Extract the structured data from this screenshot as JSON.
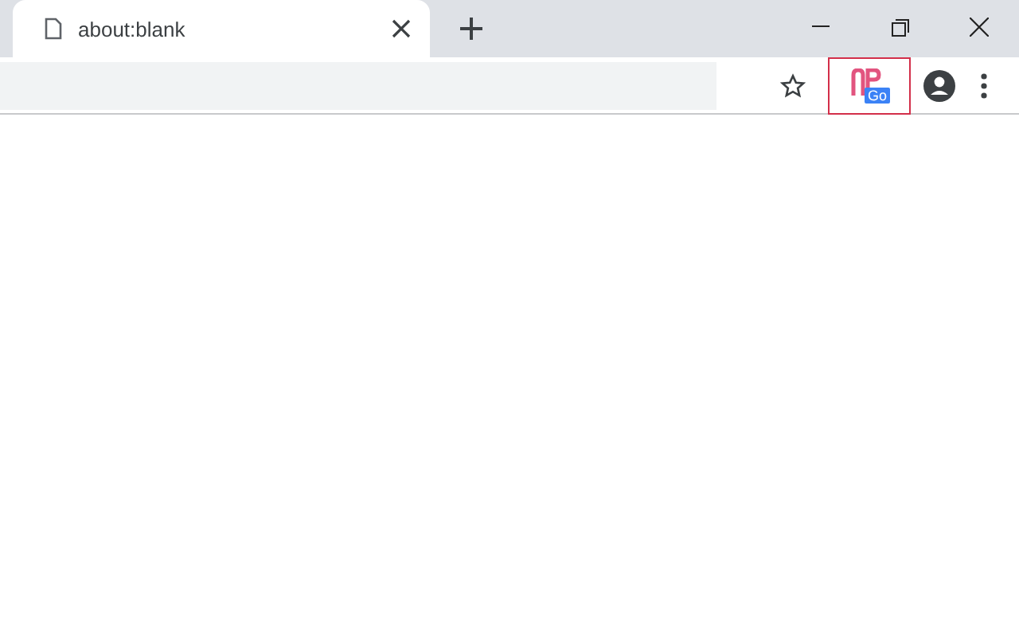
{
  "tab": {
    "title": "about:blank",
    "selected": true
  },
  "extension": {
    "badge": "Go",
    "highlighted": true
  }
}
